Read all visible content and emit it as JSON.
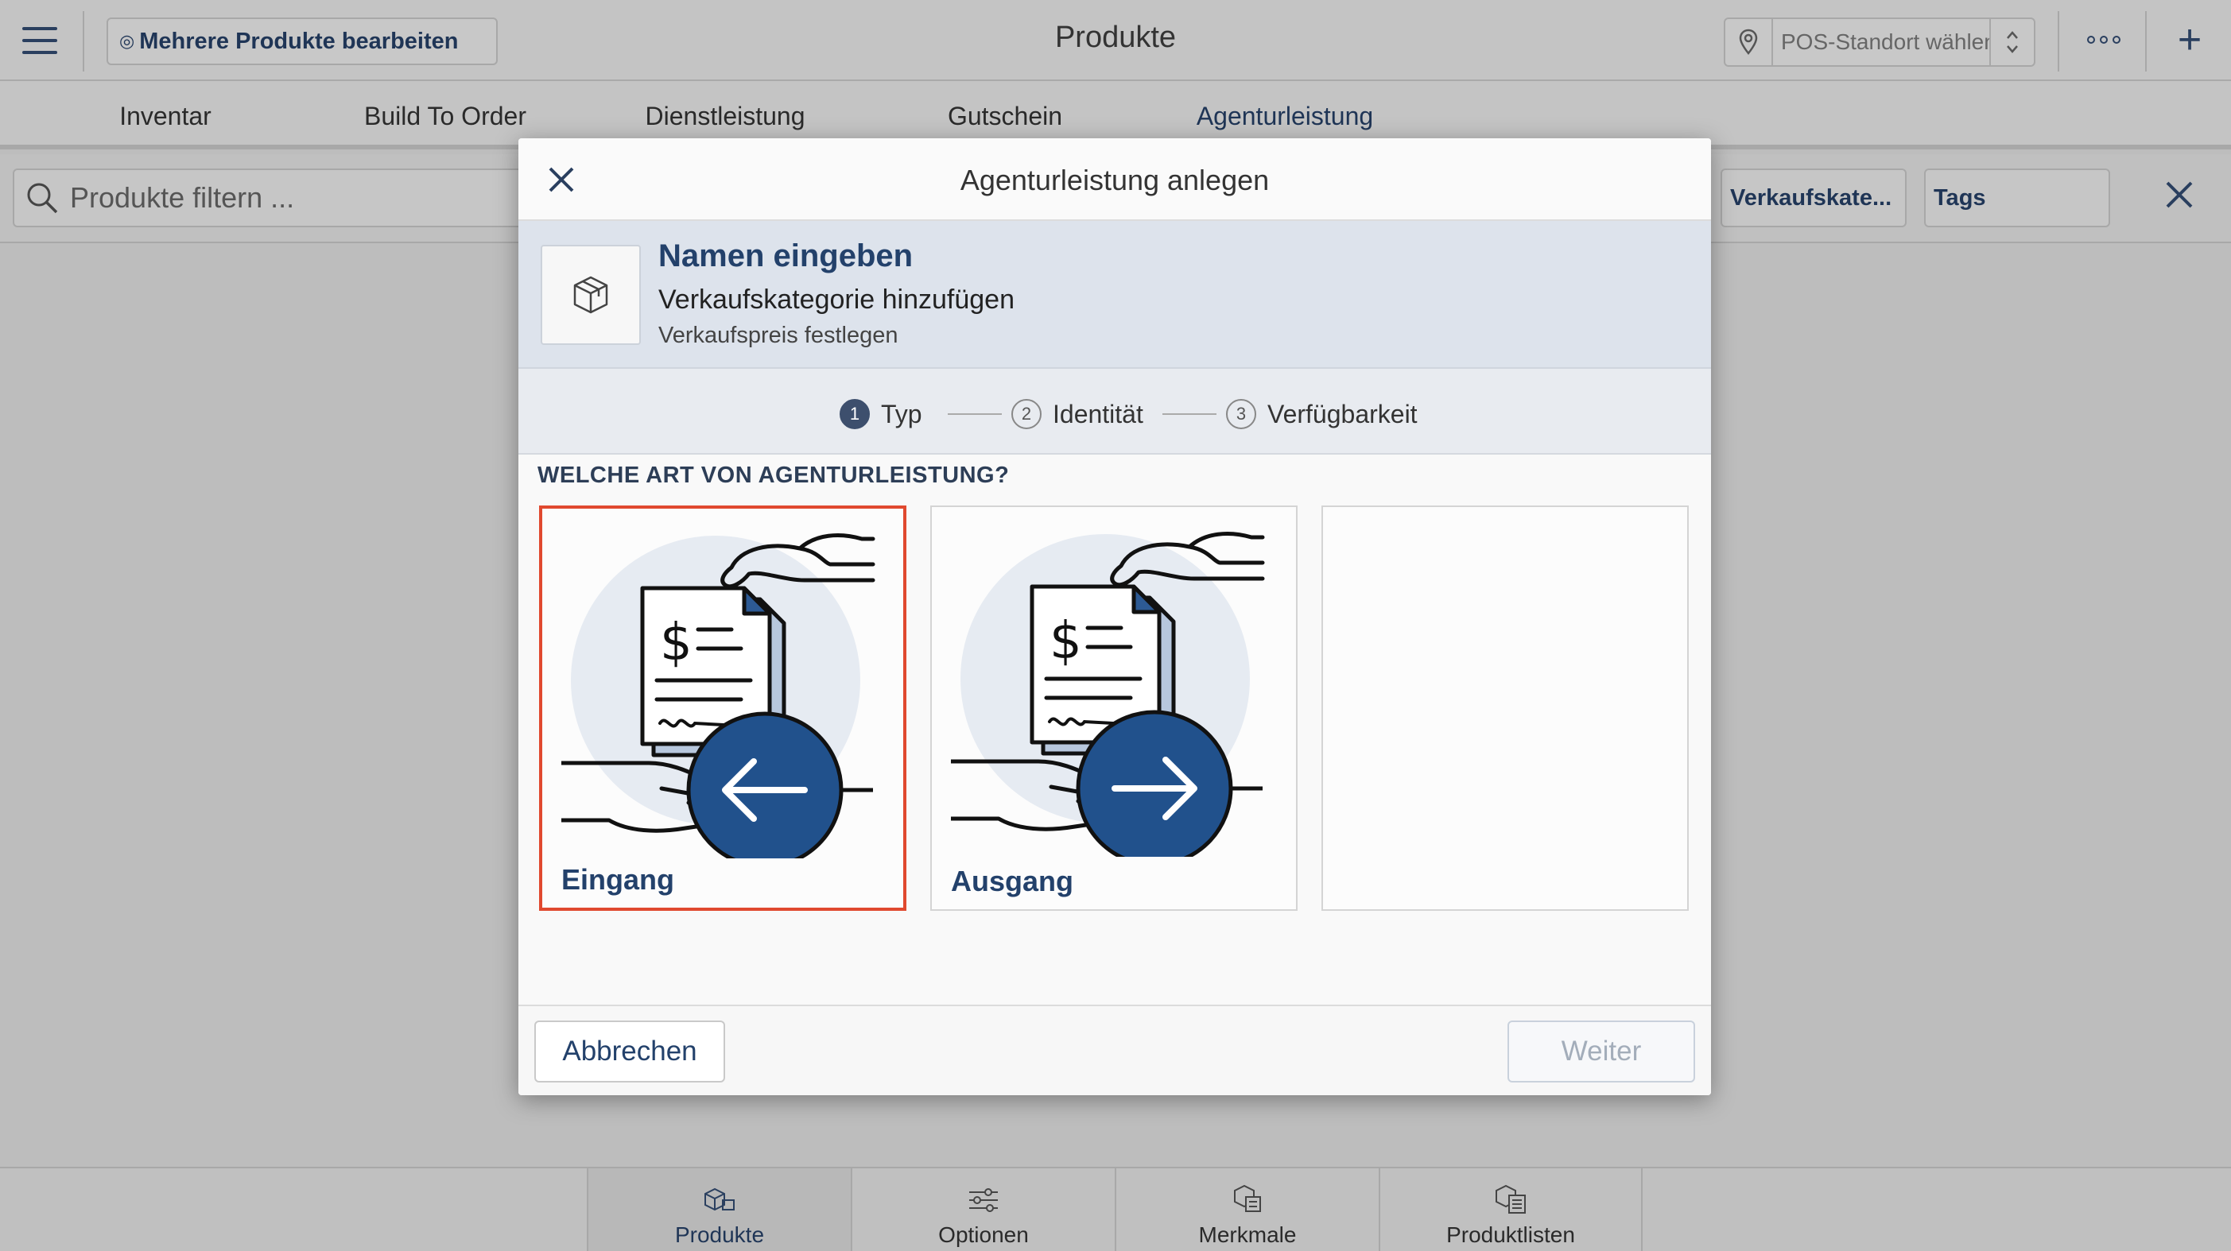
{
  "header": {
    "multi_edit_label": "Mehrere Produkte bearbeiten",
    "title": "Produkte",
    "pos_placeholder": "POS-Standort wählen..."
  },
  "tabs": [
    {
      "label": "Inventar"
    },
    {
      "label": "Build To Order"
    },
    {
      "label": "Dienstleistung"
    },
    {
      "label": "Gutschein"
    },
    {
      "label": "Agenturleistung"
    }
  ],
  "filter": {
    "search_placeholder": "Produkte filtern ...",
    "chip_category": "Verkaufskate...",
    "chip_tags": "Tags"
  },
  "bottom_nav": [
    {
      "label": "Produkte"
    },
    {
      "label": "Optionen"
    },
    {
      "label": "Merkmale"
    },
    {
      "label": "Produktlisten"
    }
  ],
  "modal": {
    "title": "Agenturleistung anlegen",
    "summary": {
      "line1": "Namen eingeben",
      "line2": "Verkaufskategorie hinzufügen",
      "line3": "Verkaufspreis festlegen"
    },
    "steps": [
      {
        "num": "1",
        "label": "Typ"
      },
      {
        "num": "2",
        "label": "Identität"
      },
      {
        "num": "3",
        "label": "Verfügbarkeit"
      }
    ],
    "question": "WELCHE ART VON AGENTURLEISTUNG?",
    "options": [
      {
        "label": "Eingang"
      },
      {
        "label": "Ausgang"
      }
    ],
    "cancel_label": "Abbrechen",
    "next_label": "Weiter"
  },
  "colors": {
    "accent_navy": "#23416b",
    "selection_border": "#e0492f",
    "illustration_circle": "#e6ebf2"
  }
}
